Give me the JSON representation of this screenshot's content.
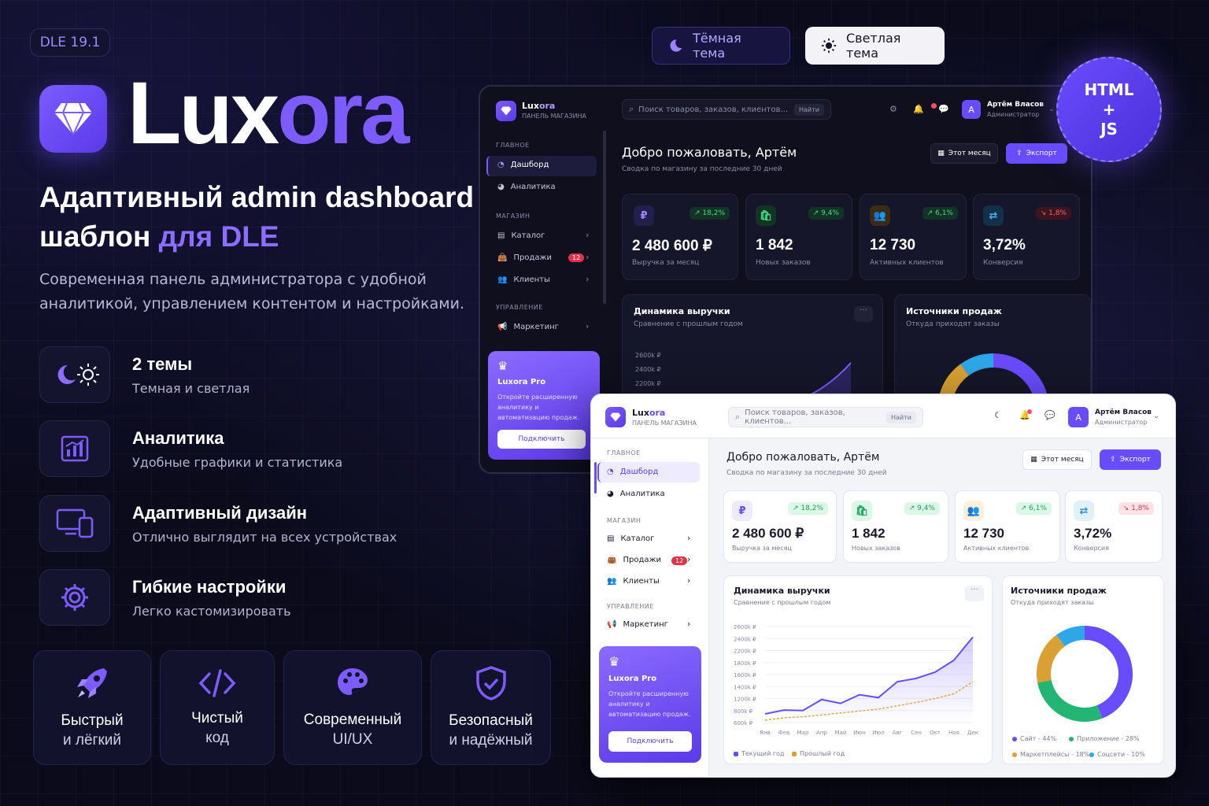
{
  "version": "DLE 19.1",
  "brand": {
    "part1": "Lux",
    "part2": "ora"
  },
  "headline": {
    "line1": "Адаптивный admin dashboard",
    "line2a": "шаблон ",
    "line2b": "для DLE"
  },
  "description": "Современная панель администратора с удобной аналитикой, управлением контентом и настройками.",
  "features": [
    {
      "title": "2 темы",
      "subtitle": "Темная и светлая",
      "icon": "theme-icon"
    },
    {
      "title": "Аналитика",
      "subtitle": "Удобные графики и статистика",
      "icon": "chart-icon"
    },
    {
      "title": "Адаптивный дизайн",
      "subtitle": "Отлично выглядит на всех устройствах",
      "icon": "devices-icon"
    },
    {
      "title": "Гибкие настройки",
      "subtitle": "Легко кастомизировать",
      "icon": "gear-icon"
    }
  ],
  "cards": [
    {
      "l1": "Быстрый",
      "l2": "и лёгкий",
      "icon": "rocket-icon"
    },
    {
      "l1": "Чистый",
      "l2": "код",
      "icon": "code-icon"
    },
    {
      "l1": "Современный",
      "l2": "UI/UX",
      "icon": "palette-icon"
    },
    {
      "l1": "Безопасный",
      "l2": "и надёжный",
      "icon": "shield-icon"
    }
  ],
  "themes": {
    "dark": "Тёмная тема",
    "light": "Светлая тема"
  },
  "badge": {
    "l1": "HTML",
    "l2": "+",
    "l3": "JS"
  },
  "dashboard": {
    "brand": "Lux",
    "brand_accent": "ora",
    "subtitle": "ПАНЕЛЬ МАГАЗИНА",
    "search_placeholder": "Поиск товаров, заказов, клиентов...",
    "search_button": "Найти",
    "user_initial": "A",
    "user_name": "Артём Власов",
    "user_role": "Администратор",
    "welcome": "Добро пожаловать, Артём",
    "welcome_sub": "Сводка по магазину за последние 30 дней",
    "period_button": "Этот месяц",
    "export_button": "Экспорт",
    "sections": {
      "main": "ГЛАВНОЕ",
      "shop": "МАГАЗИН",
      "manage": "УПРАВЛЕНИЕ"
    },
    "nav": {
      "dashboard": "Дашборд",
      "analytics": "Аналитика",
      "catalog": "Каталог",
      "sales": "Продажи",
      "clients": "Клиенты",
      "marketing": "Маркетинг"
    },
    "sales_count": "12",
    "pro": {
      "title": "Luxora Pro",
      "text": "Откройте расширенную аналитику и автоматизацию продаж.",
      "button": "Подключить"
    },
    "stats": [
      {
        "value": "2 480 600 ₽",
        "label": "Выручка за месяц",
        "change": "↗ 18,2%",
        "dir": "up",
        "symbol": "₽"
      },
      {
        "value": "1 842",
        "label": "Новых заказов",
        "change": "↗ 9,4%",
        "dir": "up",
        "symbol": "🛍"
      },
      {
        "value": "12 730",
        "label": "Активных клиентов",
        "change": "↗ 6,1%",
        "dir": "up",
        "symbol": "👥"
      },
      {
        "value": "3,72%",
        "label": "Конверсия",
        "change": "↘ 1,8%",
        "dir": "down",
        "symbol": "⇄"
      }
    ],
    "revenue_title": "Динамика выручки",
    "revenue_sub": "Сравнение с прошлым годом",
    "sources_title": "Источники продаж",
    "sources_sub": "Откуда приходят заказы",
    "more": "···"
  },
  "colors": {
    "accent": "#6a4cff",
    "green": "#22b573",
    "amber": "#d9a033",
    "blue": "#2ea7e8"
  },
  "chart_data": [
    {
      "type": "line",
      "title": "Динамика выручки",
      "subtitle": "Сравнение с прошлым годом",
      "categories": [
        "Янв",
        "Фев",
        "Мар",
        "Апр",
        "Май",
        "Июн",
        "Июл",
        "Авг",
        "Сен",
        "Окт",
        "Ноя",
        "Дек"
      ],
      "y_ticks": [
        "2600k ₽",
        "2400k ₽",
        "2200k ₽",
        "1800k ₽",
        "1600k ₽",
        "1400k ₽",
        "1200k ₽",
        "800k ₽",
        "600k ₽"
      ],
      "series": [
        {
          "name": "Текущий год",
          "values": [
            780,
            860,
            850,
            1080,
            1000,
            1180,
            1120,
            1450,
            1520,
            1650,
            1900,
            2380
          ]
        },
        {
          "name": "Прошлый год",
          "values": [
            650,
            700,
            720,
            760,
            800,
            840,
            880,
            950,
            1020,
            1100,
            1200,
            1450
          ]
        }
      ],
      "ylim": [
        600,
        2600
      ]
    },
    {
      "type": "pie",
      "title": "Источники продаж",
      "subtitle": "Откуда приходят заказы",
      "slices": [
        {
          "name": "Сайт",
          "value": 44,
          "label": "Сайт - 44%"
        },
        {
          "name": "Приложение",
          "value": 28,
          "label": "Приложение - 28%"
        },
        {
          "name": "Маркетплейсы",
          "value": 18,
          "label": "Маркетплейсы - 18%"
        },
        {
          "name": "Соцсети",
          "value": 10,
          "label": "Соцсети - 10%"
        }
      ]
    }
  ]
}
